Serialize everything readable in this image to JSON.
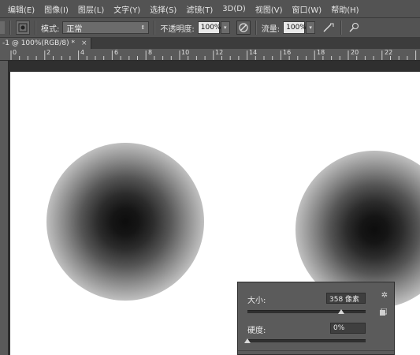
{
  "menubar": {
    "items": [
      "编辑(E)",
      "图像(I)",
      "图层(L)",
      "文字(Y)",
      "选择(S)",
      "滤镜(T)",
      "3D(D)",
      "视图(V)",
      "窗口(W)",
      "帮助(H)"
    ]
  },
  "options": {
    "mode_label": "模式:",
    "mode_value": "正常",
    "opacity_label": "不透明度:",
    "opacity_value": "100%",
    "flow_label": "流量:",
    "flow_value": "100%",
    "icons": [
      "brush-preset-icon",
      "airbrush-pressure-icon",
      "airbrush-icon",
      "pen-pressure-icon"
    ]
  },
  "document": {
    "tab_title": "-1 @ 100%(RGB/8) *",
    "close_symbol": "×"
  },
  "ruler": {
    "labels": [
      "0",
      "2",
      "4",
      "6",
      "8",
      "10",
      "12",
      "14",
      "16",
      "18",
      "20",
      "22"
    ]
  },
  "brush_panel": {
    "size_label": "大小:",
    "size_value": "358 像素",
    "hardness_label": "硬度:",
    "hardness_value": "0%",
    "size_slider_fraction": 0.79,
    "hardness_slider_fraction": 0.0
  },
  "colors": {
    "ui_gray": "#535353",
    "canvas": "#ffffff",
    "brush_center": "#0d0d0d"
  }
}
